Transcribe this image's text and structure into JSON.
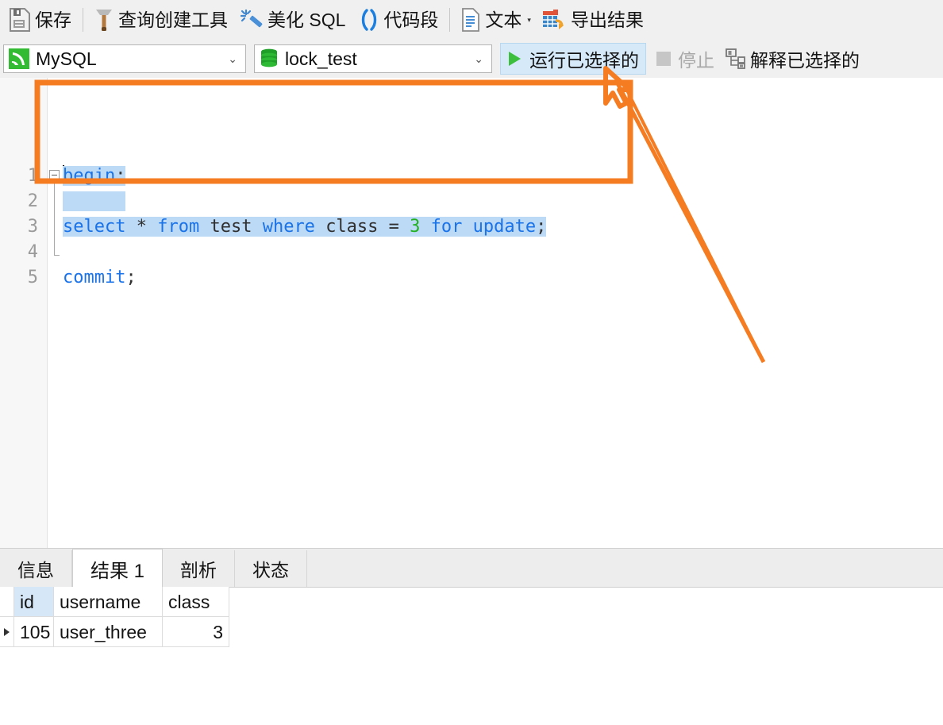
{
  "toolbar": {
    "items": [
      {
        "label": "保存",
        "icon": "save-icon"
      },
      {
        "label": "查询创建工具",
        "icon": "query-builder-icon"
      },
      {
        "label": "美化 SQL",
        "icon": "beautify-wand-icon"
      },
      {
        "label": "代码段",
        "icon": "code-snippet-icon"
      },
      {
        "label": "文本",
        "icon": "text-document-icon"
      },
      {
        "label": "导出结果",
        "icon": "export-results-icon"
      }
    ]
  },
  "connection_bar": {
    "connection": {
      "value": "MySQL",
      "icon": "mysql-dolphin-icon",
      "caret": "⌄"
    },
    "database": {
      "value": "lock_test",
      "icon": "database-cylinder-icon",
      "caret": "⌄"
    },
    "run_button": {
      "label": "运行已选择的",
      "icon": "play-icon"
    },
    "stop_button": {
      "label": "停止",
      "icon": "stop-square-icon",
      "enabled": false
    },
    "explain_button": {
      "label": "解释已选择的",
      "icon": "explain-plan-icon"
    }
  },
  "editor": {
    "lines": [
      {
        "no": "1",
        "tokens": [
          {
            "t": "begin",
            "c": "kw",
            "sel": true
          },
          {
            "t": ";",
            "c": "pn",
            "sel": true
          }
        ]
      },
      {
        "no": "2",
        "tokens": []
      },
      {
        "no": "3",
        "tokens": [
          {
            "t": "select",
            "c": "kw",
            "sel": true
          },
          {
            "t": " ",
            "c": "pn",
            "sel": true
          },
          {
            "t": "*",
            "c": "id",
            "sel": true
          },
          {
            "t": " ",
            "c": "pn",
            "sel": true
          },
          {
            "t": "from",
            "c": "kw",
            "sel": true
          },
          {
            "t": " ",
            "c": "pn",
            "sel": true
          },
          {
            "t": "test",
            "c": "id",
            "sel": true
          },
          {
            "t": " ",
            "c": "pn",
            "sel": true
          },
          {
            "t": "where",
            "c": "kw",
            "sel": true
          },
          {
            "t": " ",
            "c": "pn",
            "sel": true
          },
          {
            "t": "class",
            "c": "id",
            "sel": true
          },
          {
            "t": " ",
            "c": "pn",
            "sel": true
          },
          {
            "t": "=",
            "c": "id",
            "sel": true
          },
          {
            "t": " ",
            "c": "pn",
            "sel": true
          },
          {
            "t": "3",
            "c": "num",
            "sel": true
          },
          {
            "t": " ",
            "c": "pn",
            "sel": true
          },
          {
            "t": "for",
            "c": "kw",
            "sel": true
          },
          {
            "t": " ",
            "c": "pn",
            "sel": true
          },
          {
            "t": "update",
            "c": "kw",
            "sel": true
          },
          {
            "t": ";",
            "c": "pn",
            "sel": true
          }
        ]
      },
      {
        "no": "4",
        "tokens": []
      },
      {
        "no": "5",
        "tokens": [
          {
            "t": "commit",
            "c": "kw",
            "sel": false
          },
          {
            "t": ";",
            "c": "pn",
            "sel": false
          }
        ]
      }
    ]
  },
  "results": {
    "tabs": [
      {
        "label": "信息",
        "active": false
      },
      {
        "label": "结果 1",
        "active": true
      },
      {
        "label": "剖析",
        "active": false
      },
      {
        "label": "状态",
        "active": false
      }
    ],
    "table": {
      "columns": [
        "id",
        "username",
        "class"
      ],
      "rows": [
        [
          "105",
          "user_three",
          "3"
        ]
      ]
    }
  },
  "annotation": {
    "color": "#f57c20",
    "shape": "rectangle-with-cursor-arrow-and-leader-lines"
  }
}
